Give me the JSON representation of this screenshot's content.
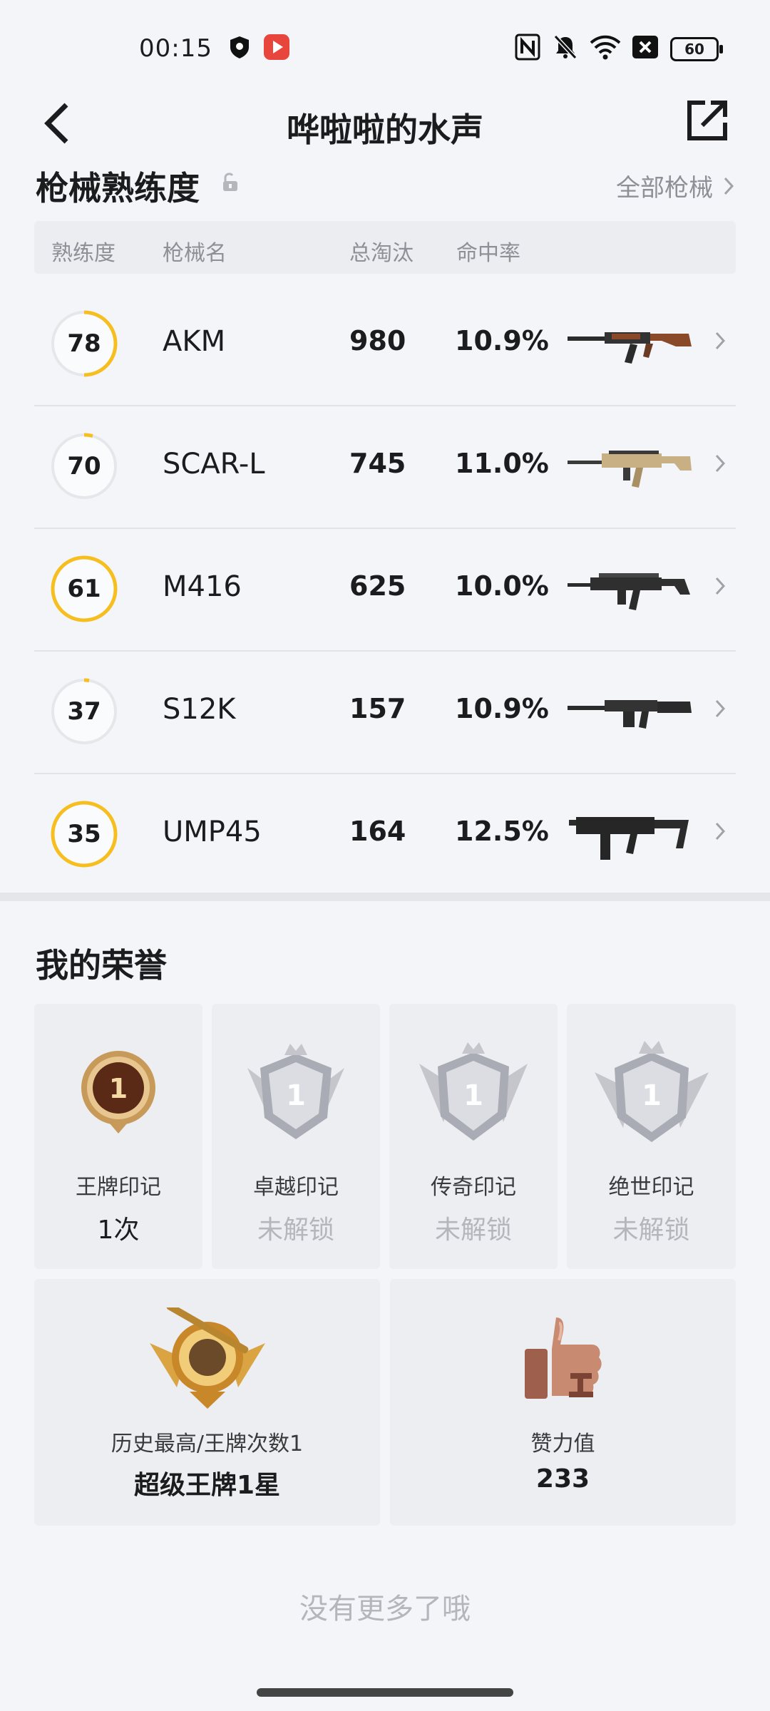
{
  "status_bar": {
    "time": "00:15",
    "battery": "60"
  },
  "header": {
    "title": "哗啦啦的水声"
  },
  "weapons_section": {
    "title": "枪械熟练度",
    "all_link": "全部枪械",
    "columns": [
      "熟练度",
      "枪械名",
      "总淘汰",
      "命中率"
    ],
    "rows": [
      {
        "proficiency": "78",
        "name": "AKM",
        "kills": "980",
        "hit_rate": "10.9%"
      },
      {
        "proficiency": "70",
        "name": "SCAR-L",
        "kills": "745",
        "hit_rate": "11.0%"
      },
      {
        "proficiency": "61",
        "name": "M416",
        "kills": "625",
        "hit_rate": "10.0%"
      },
      {
        "proficiency": "37",
        "name": "S12K",
        "kills": "157",
        "hit_rate": "10.9%"
      },
      {
        "proficiency": "35",
        "name": "UMP45",
        "kills": "164",
        "hit_rate": "12.5%"
      }
    ]
  },
  "honors_section": {
    "title": "我的荣誉",
    "marks": [
      {
        "label": "王牌印记",
        "value": "1次",
        "badge_number": "1"
      },
      {
        "label": "卓越印记",
        "value": "未解锁",
        "badge_number": "1"
      },
      {
        "label": "传奇印记",
        "value": "未解锁",
        "badge_number": "1"
      },
      {
        "label": "绝世印记",
        "value": "未解锁",
        "badge_number": "1"
      }
    ],
    "highest": {
      "label": "历史最高/王牌次数1",
      "value": "超级王牌1星"
    },
    "likes": {
      "label": "赞力值",
      "value": "233"
    }
  },
  "footer": {
    "text": "没有更多了哦"
  },
  "colors": {
    "ring_gold": "#f6be1e",
    "ring_track": "#e6e7eb",
    "muted": "#8e9097"
  },
  "icons": [
    "back-arrow-icon",
    "share-icon",
    "lock-icon",
    "chevron-right-icon",
    "nfc-icon",
    "bell-off-icon",
    "wifi-icon",
    "battery-icon"
  ]
}
